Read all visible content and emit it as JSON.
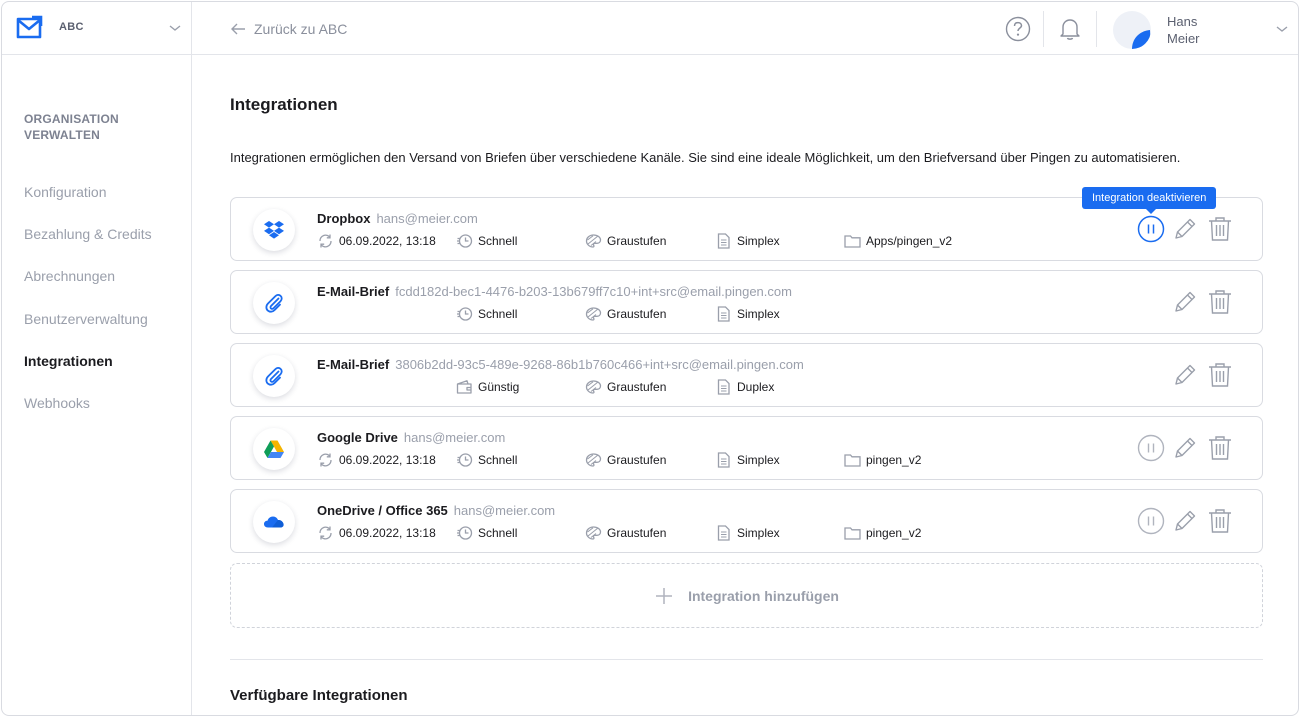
{
  "app": {
    "org_name": "ABC",
    "back_link": "Zurück zu ABC",
    "user": {
      "first_name": "Hans",
      "last_name": "Meier"
    }
  },
  "sidebar": {
    "heading": "ORGANISATION VERWALTEN",
    "items": [
      {
        "label": "Konfiguration"
      },
      {
        "label": "Bezahlung & Credits"
      },
      {
        "label": "Abrechnungen"
      },
      {
        "label": "Benutzerverwaltung"
      },
      {
        "label": "Integrationen",
        "active": true
      },
      {
        "label": "Webhooks"
      }
    ]
  },
  "main": {
    "title": "Integrationen",
    "description": "Integrationen ermöglichen den Versand von Briefen über verschiedene Kanäle. Sie sind eine ideale Möglichkeit, um den Briefversand über Pingen zu automatisieren.",
    "tooltip": "Integration deaktivieren",
    "integrations": [
      {
        "name": "Dropbox",
        "account": "hans@meier.com",
        "icon": "dropbox-icon",
        "sync": "06.09.2022, 13:18",
        "speed": "Schnell",
        "color": "Graustufen",
        "print": "Simplex",
        "folder": "Apps/pingen_v2"
      },
      {
        "name": "E-Mail-Brief",
        "account": "fcdd182d-bec1-4476-b203-13b679ff7c10+int+src@email.pingen.com",
        "icon": "paperclip-icon",
        "speed": "Schnell",
        "color": "Graustufen",
        "print": "Simplex"
      },
      {
        "name": "E-Mail-Brief",
        "account": "3806b2dd-93c5-489e-9268-86b1b760c466+int+src@email.pingen.com",
        "icon": "paperclip-icon",
        "speed": "Günstig",
        "color": "Graustufen",
        "print": "Duplex"
      },
      {
        "name": "Google Drive",
        "account": "hans@meier.com",
        "icon": "google-drive-icon",
        "sync": "06.09.2022, 13:18",
        "speed": "Schnell",
        "color": "Graustufen",
        "print": "Simplex",
        "folder": "pingen_v2"
      },
      {
        "name": "OneDrive / Office 365",
        "account": "hans@meier.com",
        "icon": "onedrive-icon",
        "sync": "06.09.2022, 13:18",
        "speed": "Schnell",
        "color": "Graustufen",
        "print": "Simplex",
        "folder": "pingen_v2"
      }
    ],
    "add_label": "Integration hinzufügen",
    "available_title": "Verfügbare Integrationen"
  },
  "colors": {
    "accent": "#1a6cf0",
    "muted": "#9a9fab",
    "border": "#d9dbe1"
  }
}
